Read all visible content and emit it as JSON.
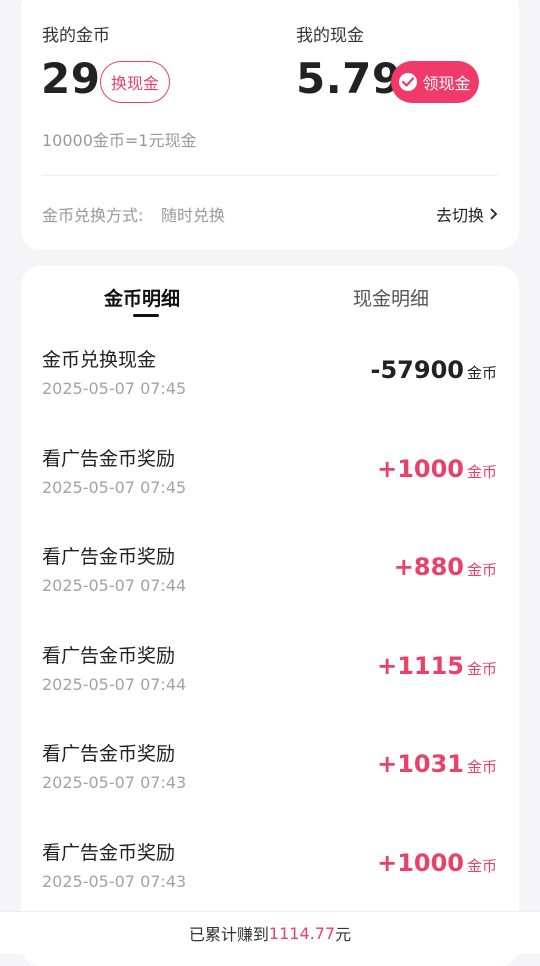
{
  "coins": {
    "label": "我的金币",
    "value": "29",
    "exchange_button": "换现金",
    "rate": "10000金币=1元现金",
    "method_label": "金币兑换方式:",
    "method_value": "随时兑换",
    "switch_label": "去切换"
  },
  "cash": {
    "label": "我的现金",
    "value": "5.79",
    "withdraw_button": "领现金"
  },
  "tabs": [
    {
      "label": "金币明细",
      "active": true
    },
    {
      "label": "现金明细",
      "active": false
    }
  ],
  "records": [
    {
      "title": "金币兑换现金",
      "time": "2025-05-07 07:45",
      "amount": "-57900",
      "unit": "金币",
      "sign": "neg"
    },
    {
      "title": "看广告金币奖励",
      "time": "2025-05-07 07:45",
      "amount": "+1000",
      "unit": "金币",
      "sign": "pos"
    },
    {
      "title": "看广告金币奖励",
      "time": "2025-05-07 07:44",
      "amount": "+880",
      "unit": "金币",
      "sign": "pos"
    },
    {
      "title": "看广告金币奖励",
      "time": "2025-05-07 07:44",
      "amount": "+1115",
      "unit": "金币",
      "sign": "pos"
    },
    {
      "title": "看广告金币奖励",
      "time": "2025-05-07 07:43",
      "amount": "+1031",
      "unit": "金币",
      "sign": "pos"
    },
    {
      "title": "看广告金币奖励",
      "time": "2025-05-07 07:43",
      "amount": "+1000",
      "unit": "金币",
      "sign": "pos"
    }
  ],
  "footer": {
    "prefix": "已累计赚到",
    "amount": "1114.77",
    "suffix": "元"
  },
  "colors": {
    "accent": "#ee3f6c",
    "positive": "#e8426a",
    "background": "#f5f5f7"
  }
}
